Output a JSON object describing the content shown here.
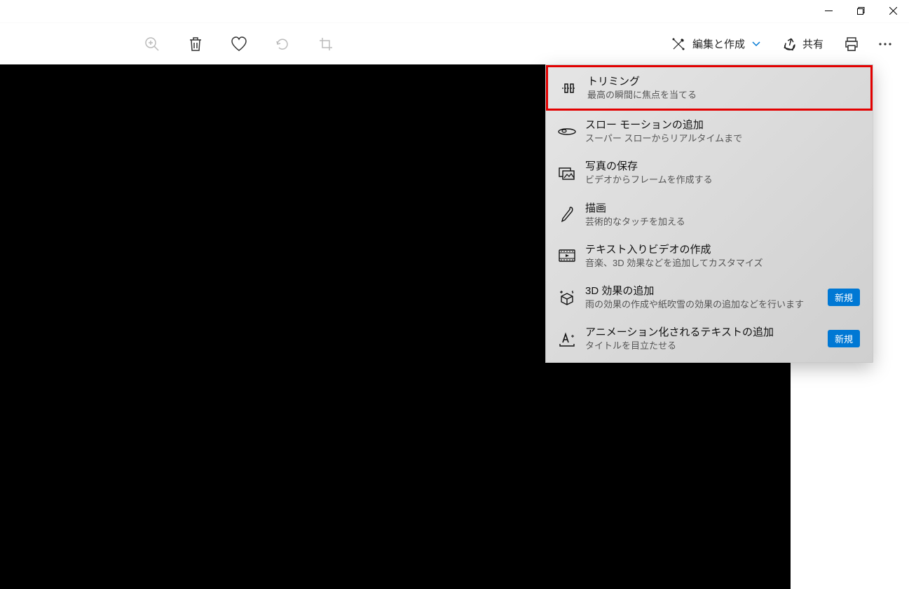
{
  "titlebar": {
    "minimize": "minimize",
    "maximize": "maximize",
    "close": "close"
  },
  "toolbar": {
    "edit_create_label": "編集と作成",
    "share_label": "共有"
  },
  "menu": {
    "items": [
      {
        "title": "トリミング",
        "desc": "最高の瞬間に焦点を当てる",
        "highlighted": true,
        "badge": null
      },
      {
        "title": "スロー モーションの追加",
        "desc": "スーパー スローからリアルタイムまで",
        "highlighted": false,
        "badge": null
      },
      {
        "title": "写真の保存",
        "desc": "ビデオからフレームを作成する",
        "highlighted": false,
        "badge": null
      },
      {
        "title": "描画",
        "desc": "芸術的なタッチを加える",
        "highlighted": false,
        "badge": null
      },
      {
        "title": "テキスト入りビデオの作成",
        "desc": "音楽、3D 効果などを追加してカスタマイズ",
        "highlighted": false,
        "badge": null
      },
      {
        "title": "3D 効果の追加",
        "desc": "雨の効果の作成や紙吹雪の効果の追加などを行います",
        "highlighted": false,
        "badge": "新規"
      },
      {
        "title": "アニメーション化されるテキストの追加",
        "desc": "タイトルを目立たせる",
        "highlighted": false,
        "badge": "新規"
      }
    ]
  }
}
